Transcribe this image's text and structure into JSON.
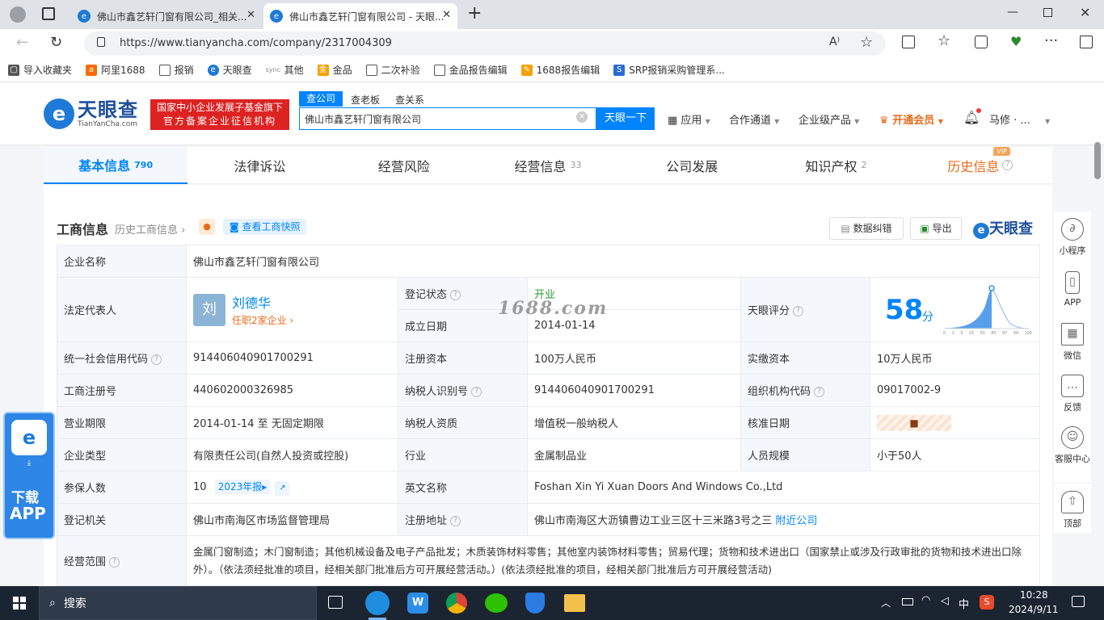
{
  "browser": {
    "tabs": [
      {
        "title": "佛山市鑫艺轩门窗有限公司_相关...",
        "active": false
      },
      {
        "title": "佛山市鑫艺轩门窗有限公司 - 天眼...",
        "active": true
      }
    ],
    "url": "https://www.tianyancha.com/company/2317004309",
    "bookmarks": [
      "导入收藏夹",
      "阿里1688",
      "报销",
      "天眼查",
      "其他",
      "金品",
      "二次补验",
      "金品报告编辑",
      "1688报告编辑",
      "SRP报销采购管理系..."
    ]
  },
  "site": {
    "logo_text": "天眼查",
    "logo_sub": "TianYanCha.com",
    "badge_line1": "国家中小企业发展子基金旗下",
    "badge_line2": "官方备案企业征信机构",
    "search_tabs": [
      "查公司",
      "查老板",
      "查关系"
    ],
    "search_value": "佛山市鑫艺轩门窗有限公司",
    "search_button": "天眼一下",
    "nav": [
      "应用",
      "合作通道",
      "企业级产品",
      "开通会员"
    ],
    "user": "马修 · ...",
    "tabs": [
      {
        "label": "基本信息",
        "count": "790"
      },
      {
        "label": "法律诉讼",
        "count": ""
      },
      {
        "label": "经营风险",
        "count": ""
      },
      {
        "label": "经营信息",
        "count": "33"
      },
      {
        "label": "公司发展",
        "count": ""
      },
      {
        "label": "知识产权",
        "count": "2"
      },
      {
        "label": "历史信息",
        "count": ""
      }
    ],
    "vip_badge": "VIP"
  },
  "section": {
    "title": "工商信息",
    "history_link": "历史工商信息",
    "snapshot_btn": "查看工商快照",
    "correct_btn": "数据纠错",
    "export_btn": "导出",
    "brand": "天眼查"
  },
  "info": {
    "company_name_label": "企业名称",
    "company_name": "佛山市鑫艺轩门窗有限公司",
    "legal_rep_label": "法定代表人",
    "legal_rep_avatar": "刘",
    "legal_rep": "刘德华",
    "legal_rep_sub": "任职2家企业",
    "reg_status_label": "登记状态",
    "reg_status": "开业",
    "found_date_label": "成立日期",
    "found_date": "2014-01-14",
    "score_label": "天眼评分",
    "score": "58",
    "score_unit": "分",
    "credit_code_label": "统一社会信用代码",
    "credit_code": "914406040901700291",
    "reg_capital_label": "注册资本",
    "reg_capital": "100万人民币",
    "paid_capital_label": "实缴资本",
    "paid_capital": "10万人民币",
    "reg_no_label": "工商注册号",
    "reg_no": "440602000326985",
    "taxpayer_id_label": "纳税人识别号",
    "taxpayer_id": "914406040901700291",
    "org_code_label": "组织机构代码",
    "org_code": "09017002-9",
    "term_label": "营业期限",
    "term": "2014-01-14 至 无固定期限",
    "taxpayer_qual_label": "纳税人资质",
    "taxpayer_qual": "增值税一般纳税人",
    "approve_date_label": "核准日期",
    "type_label": "企业类型",
    "type": "有限责任公司(自然人投资或控股)",
    "industry_label": "行业",
    "industry": "金属制品业",
    "staff_label": "人员规模",
    "staff": "小于50人",
    "insured_label": "参保人数",
    "insured": "10",
    "insured_year": "2023年报",
    "en_name_label": "英文名称",
    "en_name": "Foshan Xin Yi Xuan Doors And Windows Co.,Ltd",
    "authority_label": "登记机关",
    "authority": "佛山市南海区市场监督管理局",
    "address_label": "注册地址",
    "address": "佛山市南海区大沥镇曹边工业三区十三米路3号之三",
    "nearby": "附近公司",
    "scope_label": "经营范围",
    "scope": "金属门窗制造；木门窗制造；其他机械设备及电子产品批发；木质装饰材料零售；其他室内装饰材料零售；贸易代理；货物和技术进出口（国家禁止或涉及行政审批的货物和技术进出口除外）。（依法须经批准的项目，经相关部门批准后方可开展经营活动。）(依法须经批准的项目，经相关部门批准后方可开展经营活动)"
  },
  "watermark": "1688.com",
  "side": [
    "小程序",
    "APP",
    "微信",
    "反馈",
    "客服中心",
    "顶部"
  ],
  "download": {
    "line1": "下载",
    "line2": "APP"
  },
  "chart_ticks": [
    "0",
    "1",
    "3",
    "15",
    "50",
    "85",
    "97",
    "99",
    "100"
  ],
  "taskbar": {
    "search": "搜索",
    "time": "10:28",
    "date": "2024/9/11",
    "ime": "中"
  }
}
